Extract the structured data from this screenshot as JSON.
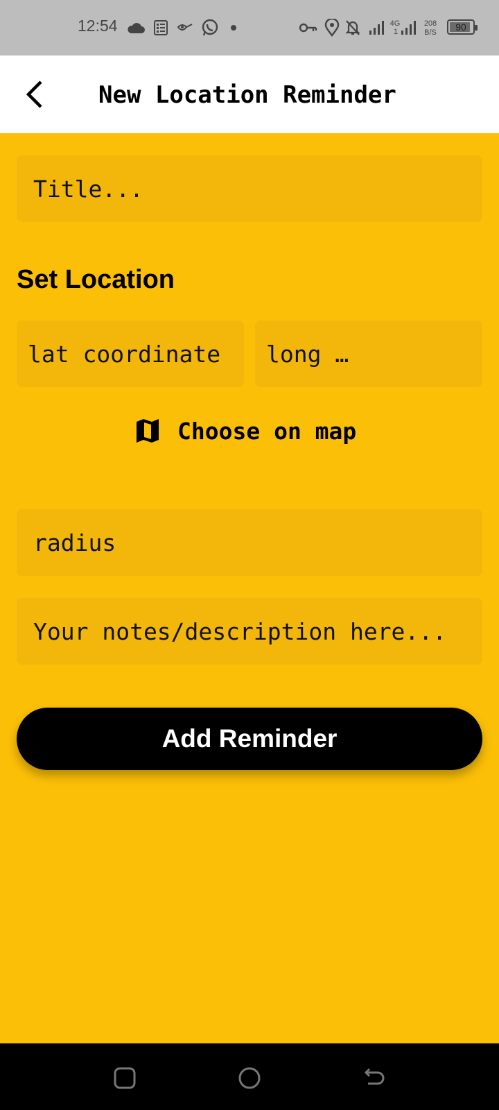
{
  "status_bar": {
    "time": "12:54",
    "network_type": "4G",
    "network_sub": "1",
    "data_rate": "208",
    "data_rate_unit": "B/S",
    "battery_percent": "90",
    "battery_level": 0.9,
    "icons": [
      "cloud-icon",
      "notes-icon",
      "app-notification-icon",
      "whatsapp-icon",
      "dot-icon",
      "vpn-key-icon",
      "location-icon",
      "bell-off-icon",
      "signal-icon",
      "signal-4g-icon",
      "battery-icon"
    ]
  },
  "app_bar": {
    "title": "New Location Reminder",
    "back_icon": "back-arrow-icon"
  },
  "form": {
    "title_placeholder": "Title...",
    "section_label": "Set Location",
    "lat_placeholder": "lat coordinate",
    "long_placeholder": "long …",
    "choose_map_label": "Choose on map",
    "choose_map_icon": "map-icon",
    "radius_placeholder": "radius",
    "notes_placeholder": "Your notes/description here...",
    "submit_label": "Add Reminder"
  },
  "colors": {
    "background": "#FBBF07",
    "field": "#F2B70A",
    "button": "#000000",
    "button_text": "#FFFFFF"
  },
  "nav_bar": {
    "icons": [
      "recents-icon",
      "home-icon",
      "back-icon"
    ]
  }
}
